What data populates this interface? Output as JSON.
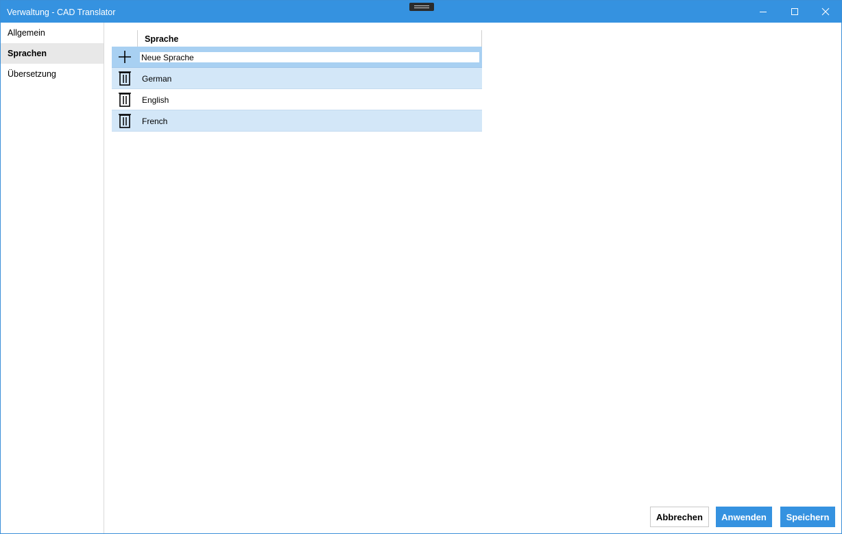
{
  "window": {
    "title": "Verwaltung - CAD Translator",
    "accent_color": "#3592e0"
  },
  "sidebar": {
    "items": [
      {
        "label": "Allgemein",
        "active": false
      },
      {
        "label": "Sprachen",
        "active": true
      },
      {
        "label": "Übersetzung",
        "active": false
      }
    ]
  },
  "grid": {
    "column_header": "Sprache",
    "new_row": {
      "placeholder": "Neue Sprache",
      "value": "Neue Sprache",
      "icon": "plus-icon"
    },
    "rows": [
      {
        "language": "German",
        "icon": "trash-icon"
      },
      {
        "language": "English",
        "icon": "trash-icon"
      },
      {
        "language": "French",
        "icon": "trash-icon"
      }
    ]
  },
  "footer": {
    "cancel_label": "Abbrechen",
    "apply_label": "Anwenden",
    "save_label": "Speichern"
  }
}
